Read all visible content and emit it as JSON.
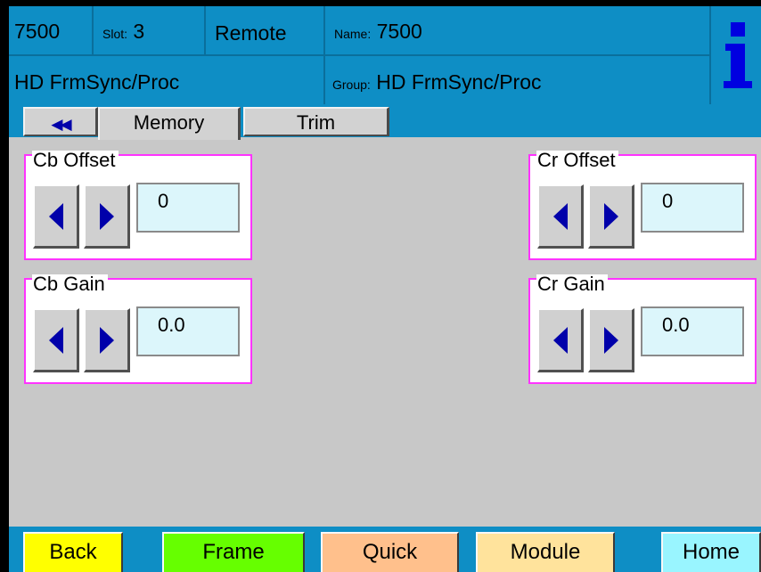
{
  "header": {
    "module": "7500",
    "slot_label": "Slot:",
    "slot_value": "3",
    "mode": "Remote",
    "name_label": "Name:",
    "name_value": "7500",
    "product": "HD FrmSync/Proc",
    "group_label": "Group:",
    "group_value": "HD FrmSync/Proc",
    "info_icon": "info-icon"
  },
  "tabs": {
    "back_icon": "◀◀",
    "items": [
      {
        "label": "Memory"
      },
      {
        "label": "Trim"
      }
    ]
  },
  "controls": [
    {
      "title": "Cb Offset",
      "value": "0"
    },
    {
      "title": "Cr Offset",
      "value": "0"
    },
    {
      "title": "Cb Gain",
      "value": "0.0"
    },
    {
      "title": "Cr Gain",
      "value": "0.0"
    }
  ],
  "footer": {
    "buttons": [
      {
        "label": "Back",
        "color": "#ffff00"
      },
      {
        "label": "Frame",
        "color": "#66ff00"
      },
      {
        "label": "Quick",
        "color": "#ffc08c"
      },
      {
        "label": "Module",
        "color": "#ffe39c"
      },
      {
        "label": "Home",
        "color": "#99f5ff"
      }
    ]
  },
  "colors": {
    "accent_blue": "#0e8ec5",
    "group_border": "#ff33ff",
    "arrow": "#0000aa",
    "value_bg": "#dcf6fb"
  }
}
